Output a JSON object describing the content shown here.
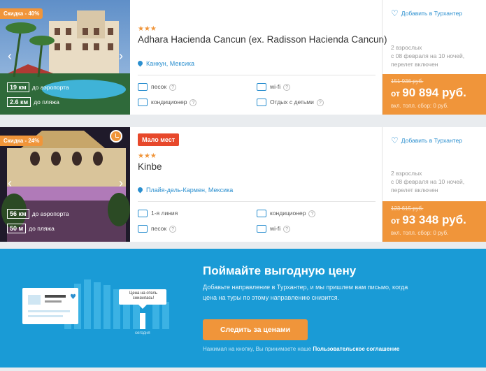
{
  "hotels": [
    {
      "discount": "Скидка - 40%",
      "stars": "★★★",
      "name": "Adhara Hacienda Cancun (ex. Radisson Hacienda Cancun)",
      "location": "Канкун, Мексика",
      "dist_airport_value": "19 км",
      "dist_airport_label": "до аэропорта",
      "dist_beach_value": "2.6 км",
      "dist_beach_label": "до пляжа",
      "amenities": [
        "песок",
        "wi-fi",
        "кондиционер",
        "Отдых с детьми"
      ],
      "favorite_label": "Добавить в Турхантер",
      "meta": [
        "2 взрослых",
        "с 08 февраля на 10 ночей,",
        "перелет включен"
      ],
      "old_price": "151 936 руб.",
      "price_prefix": "от",
      "price": "90 894 руб.",
      "fee": "вкл. топл. сбор: 0 руб."
    },
    {
      "discount": "Скидка - 24%",
      "badge": "Мало мест",
      "stars": "★★★",
      "name": "Kinbe",
      "location": "Плайя-дель-Кармен, Мексика",
      "dist_airport_value": "56 км",
      "dist_airport_label": "до аэропорта",
      "dist_beach_value": "50 м",
      "dist_beach_label": "до пляжа",
      "amenities": [
        "1-я линия",
        "кондиционер",
        "песок",
        "wi-fi"
      ],
      "favorite_label": "Добавить в Турхантер",
      "meta": [
        "2 взрослых",
        "с 08 февраля на 10 ночей,",
        "перелет включен"
      ],
      "old_price": "123 615 руб.",
      "price_prefix": "от",
      "price": "93 348 руб.",
      "fee": "вкл. топл. сбор: 0 руб."
    }
  ],
  "promo": {
    "title": "Поймайте выгодную цену",
    "text": "Добавьте направление в Турхантер, и мы пришлем вам письмо, когда цена на туры по этому направлению снизится.",
    "button": "Следить за ценами",
    "note_prefix": "Нажимая на кнопку, Вы принимаете наше",
    "note_link": "Пользовательское соглашение",
    "bubble": "Цена на отель снизилась!",
    "today": "сегодня"
  },
  "icons": [
    "chevron-left-icon",
    "chevron-right-icon",
    "map-pin-icon",
    "heart-icon",
    "clock-icon",
    "help-icon"
  ],
  "colors": {
    "accent": "#f0953a",
    "link": "#2b8fcf",
    "promo_bg": "#1a9bd6",
    "badge_red": "#e7482b"
  }
}
